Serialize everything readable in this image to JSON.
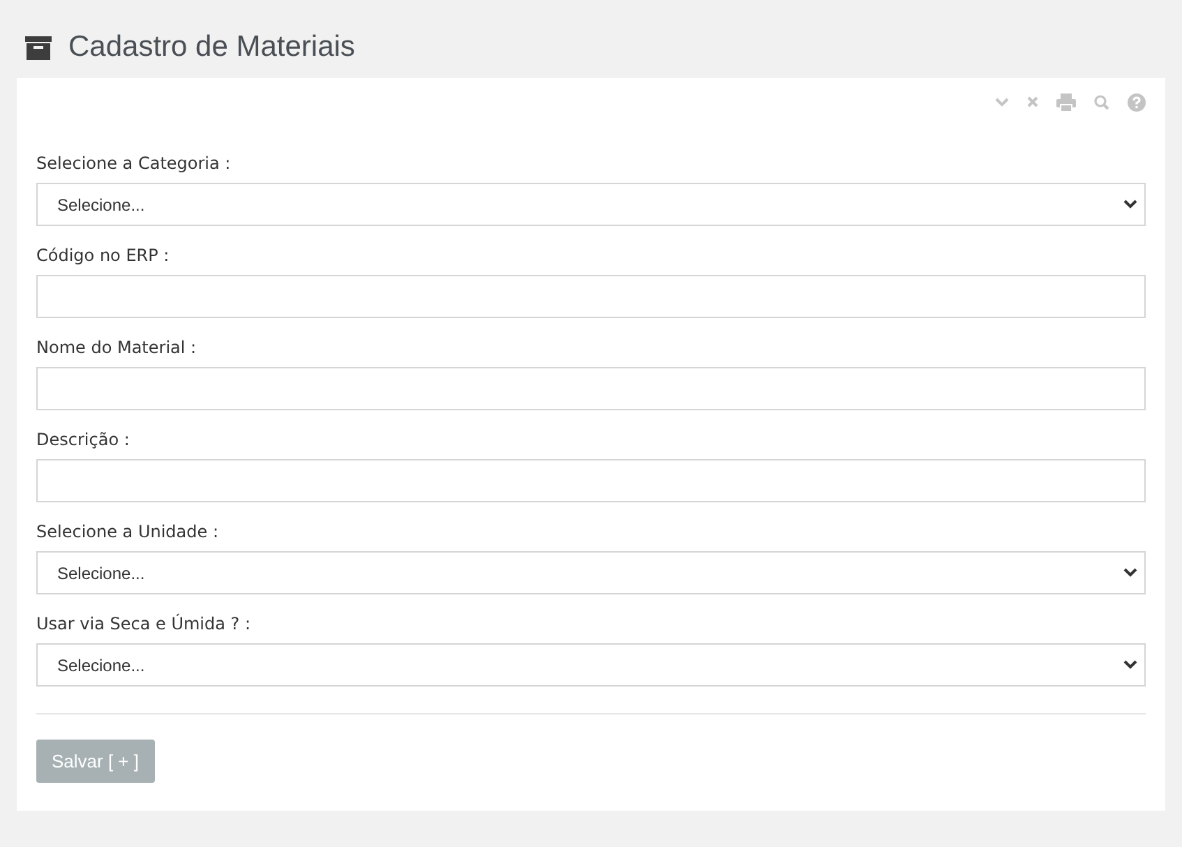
{
  "page": {
    "title": "Cadastro de Materiais"
  },
  "fields": [
    {
      "kind": "select",
      "label": "Selecione a Categoria :",
      "value": "Selecione..."
    },
    {
      "kind": "text",
      "label": "Código no ERP :"
    },
    {
      "kind": "text",
      "label": "Nome do Material :"
    },
    {
      "kind": "text",
      "label": "Descrição :"
    },
    {
      "kind": "select",
      "label": "Selecione a Unidade :",
      "value": "Selecione..."
    },
    {
      "kind": "select",
      "label": "Usar via Seca e Úmida ? :",
      "value": "Selecione..."
    }
  ],
  "save_button": {
    "label": "Salvar [ + ]"
  }
}
